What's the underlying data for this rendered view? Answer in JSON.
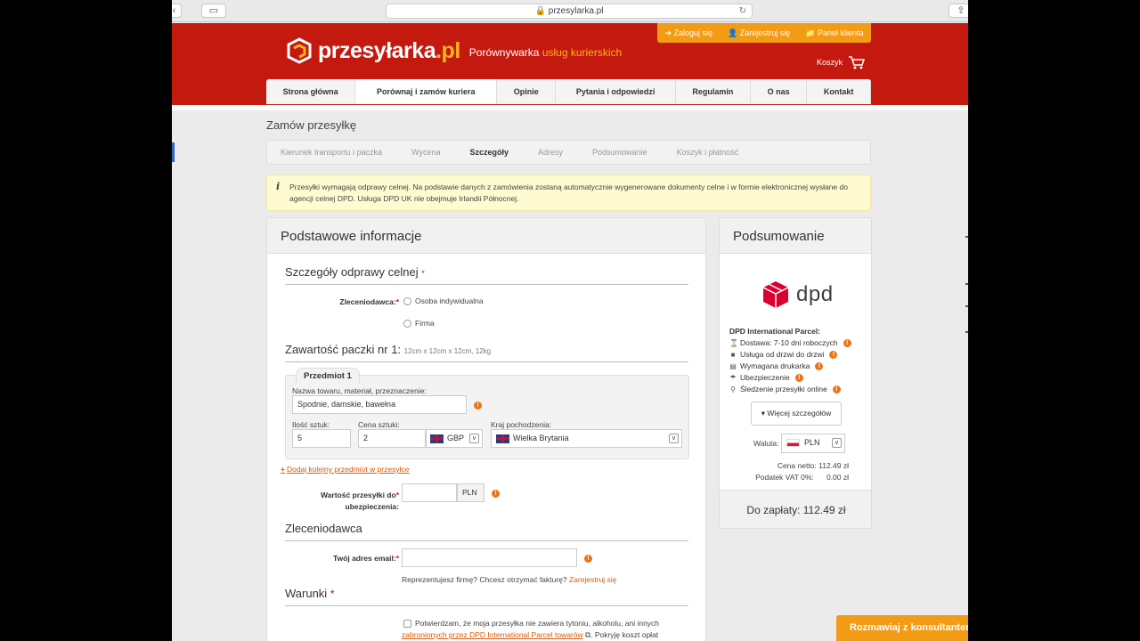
{
  "browser": {
    "url": "przesylarka.pl",
    "back": "‹",
    "forward": "›",
    "reload": "↻"
  },
  "brand": {
    "logo_main": "przesyłarka",
    "logo_tld": ".pl",
    "tagline_a": "Porównywarka ",
    "tagline_b": "usług kurierskich"
  },
  "top_links": [
    "Zaloguj się",
    "Zarejestruj się",
    "Panel klienta"
  ],
  "cart_label": "Koszyk",
  "menu": [
    "Strona główna",
    "Porównaj i zamów kuriera",
    "Opinie",
    "Pytania i odpowiedzi",
    "Regulamin",
    "O nas",
    "Kontakt"
  ],
  "menu_active_index": 1,
  "page_title": "Zamów przesyłkę",
  "steps": [
    "Kierunek transportu i paczka",
    "Wycena",
    "Szczegóły",
    "Adresy",
    "Podsumowanie",
    "Koszyk i płatność"
  ],
  "steps_current_index": 2,
  "notice": "Przesyłki wymagają odprawy celnej. Na podstawie danych z zamówienia zostaną automatycznie wygenerowane dokumenty celne i w formie elektronicznej wysłane do agencji celnej DPD. Usługa DPD UK nie obejmuje Irlandii Północnej.",
  "notice_icon": "i",
  "main": {
    "title": "Podstawowe informacje",
    "customs_title": "Szczegóły odprawy celnej",
    "requester_label": "Zleceniodawca:",
    "radio_options": [
      "Osoba indywidualna",
      "Firma"
    ],
    "package_title": "Zawartość paczki nr 1:",
    "package_dims": "12cm x 12cm x 12cm, 12kg",
    "item_tab": "Przedmiot 1",
    "desc_label": "Nazwa towaru, materiał, przeznaczenie:",
    "desc_value": "Spodnie, damskie, bawełna",
    "qty_label": "Ilość sztuk:",
    "qty_value": "5",
    "price_label": "Cena sztuki:",
    "price_value": "2",
    "currency": "GBP",
    "origin_label": "Kraj pochodzenia:",
    "origin_value": "Wielka Brytania",
    "add_item": "Dodaj kolejny przedmiot w przesyłce",
    "insurance_label_1": "Wartość przesyłki do",
    "insurance_label_2": "ubezpieczenia:",
    "insurance_currency": "PLN",
    "sender_title": "Zleceniodawca",
    "email_label": "Twój adres email:",
    "company_q": "Reprezentujesz firmę? Chcesz otrzymać fakturę?",
    "register_link": "Zarejestruj się",
    "terms_title": "Warunki",
    "terms_line1": "Potwierdzam, że moja przesyłka nie zawiera tytoniu, alkoholu, ani innych",
    "terms_link": "zabronionych przez DPD International Parcel towarów",
    "terms_line2": ". Pokryję koszt opłat"
  },
  "summary": {
    "title": "Podsumowanie",
    "carrier_logo": "dpd",
    "service": "DPD International Parcel:",
    "features": [
      {
        "icon": "hourglass-icon",
        "glyph": "⌛",
        "text": "Dostawa: 7-10 dni roboczych"
      },
      {
        "icon": "truck-icon",
        "glyph": "■",
        "text": "Usługa od drzwi do drzwi"
      },
      {
        "icon": "printer-icon",
        "glyph": "▤",
        "text": "Wymagana drukarka"
      },
      {
        "icon": "umbrella-icon",
        "glyph": "☂",
        "text": "Ubezpieczenie"
      },
      {
        "icon": "search-icon",
        "glyph": "⚲",
        "text": "Śledzenie przesyłki online"
      }
    ],
    "more_button": "▾ Więcej szczegółów",
    "currency_label": "Waluta:",
    "currency_value": "PLN",
    "net_price": "Cena netto: 112.49 zł",
    "vat": "Podatek VAT 0%:      0.00 zł",
    "total": "Do zapłaty: 112.49 zł"
  },
  "chat_button": "Rozmawiaj z konsultantem",
  "colors": {
    "brand_red": "#c4190f",
    "accent_orange": "#f29b14",
    "dpd_red": "#dc0032"
  }
}
